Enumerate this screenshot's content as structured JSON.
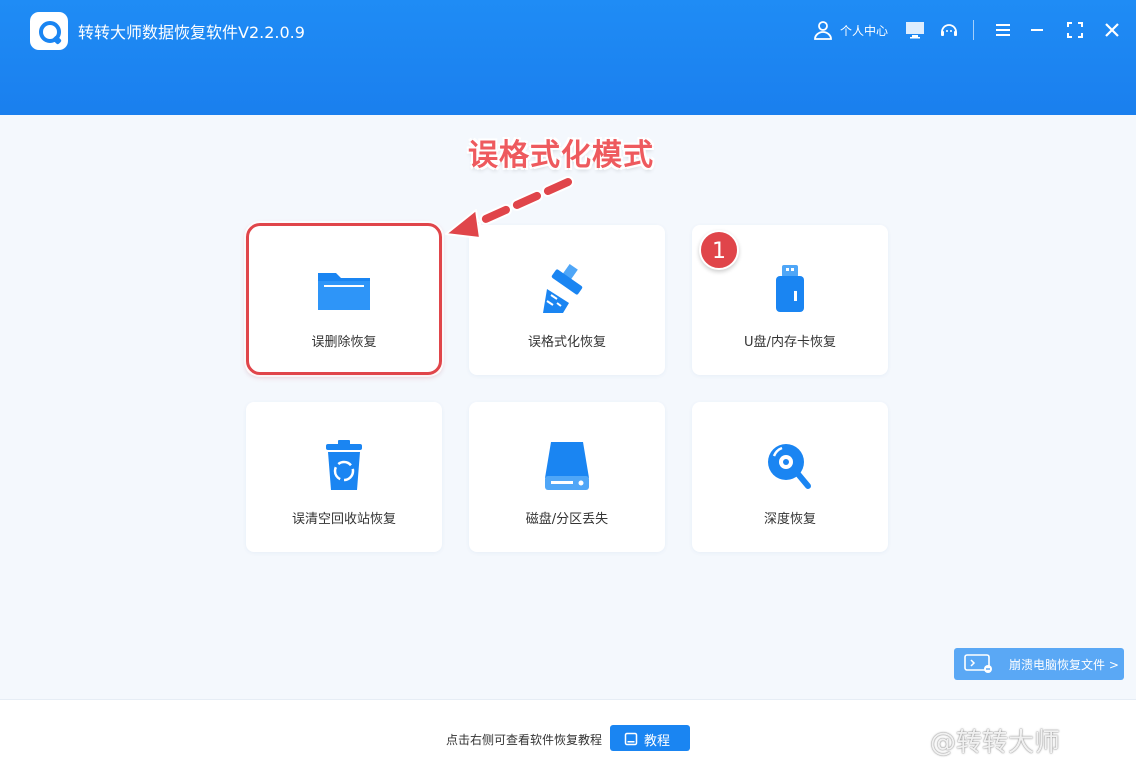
{
  "app": {
    "title": "转转大师数据恢复软件V2.2.0.9"
  },
  "header": {
    "user_label": "个人中心",
    "icons": [
      "user-icon",
      "monitor-icon",
      "headset-icon",
      "menu-icon",
      "minimize-icon",
      "maximize-icon",
      "close-icon"
    ]
  },
  "annotation": {
    "title": "误格式化模式",
    "badge": "1"
  },
  "cards": [
    {
      "label": "误删除恢复",
      "icon": "folder-icon"
    },
    {
      "label": "误格式化恢复",
      "icon": "broom-icon"
    },
    {
      "label": "U盘/内存卡恢复",
      "icon": "usb-drive-icon"
    },
    {
      "label": "误清空回收站恢复",
      "icon": "recycle-bin-icon"
    },
    {
      "label": "磁盘/分区丢失",
      "icon": "disk-icon"
    },
    {
      "label": "深度恢复",
      "icon": "deep-scan-icon"
    }
  ],
  "side_button": {
    "label": "崩溃电脑恢复文件 >",
    "icon": "pc-crash-icon"
  },
  "footer": {
    "hint": "点击右侧可查看软件恢复教程",
    "tutorial_label": "教程"
  },
  "watermark": "@转转大师",
  "colors": {
    "header": "#1a85f2",
    "accent": "#1a85f2",
    "annotation": "#e0454a",
    "side_button": "#5aa8f5"
  }
}
